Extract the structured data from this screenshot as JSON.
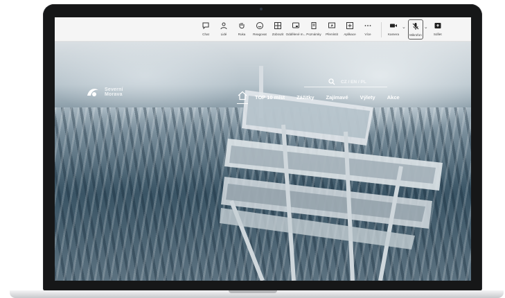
{
  "toolbar": {
    "items": [
      {
        "label": "Chat",
        "icon": "chat-icon"
      },
      {
        "label": "Lidé",
        "icon": "people-icon"
      },
      {
        "label": "Ruka",
        "icon": "raise-hand-icon"
      },
      {
        "label": "Reagovat",
        "icon": "smiley-icon"
      },
      {
        "label": "Zobrazit",
        "icon": "grid-icon"
      },
      {
        "label": "Oddělené m...",
        "icon": "rooms-icon"
      },
      {
        "label": "Poznámky",
        "icon": "notes-icon"
      },
      {
        "label": "Pfemístit",
        "icon": "share-screen-icon"
      },
      {
        "label": "Aplikace",
        "icon": "apps-icon"
      },
      {
        "label": "Více",
        "icon": "more-icon"
      }
    ],
    "camera_label": "Kamera",
    "mic_label": "Mikrofon",
    "share_label": "Sdílet"
  },
  "site": {
    "logo_line1": "Severní",
    "logo_line2": "Morava",
    "languages": "CZ / EN / PL",
    "nav": [
      "TOP 10 míst",
      "Zážitky",
      "Zajímavé",
      "Výlety",
      "Akce"
    ]
  },
  "colors": {
    "bezel": "#161718",
    "toolbar_bg": "#f5f5f5",
    "nav_text": "#ffffff"
  }
}
